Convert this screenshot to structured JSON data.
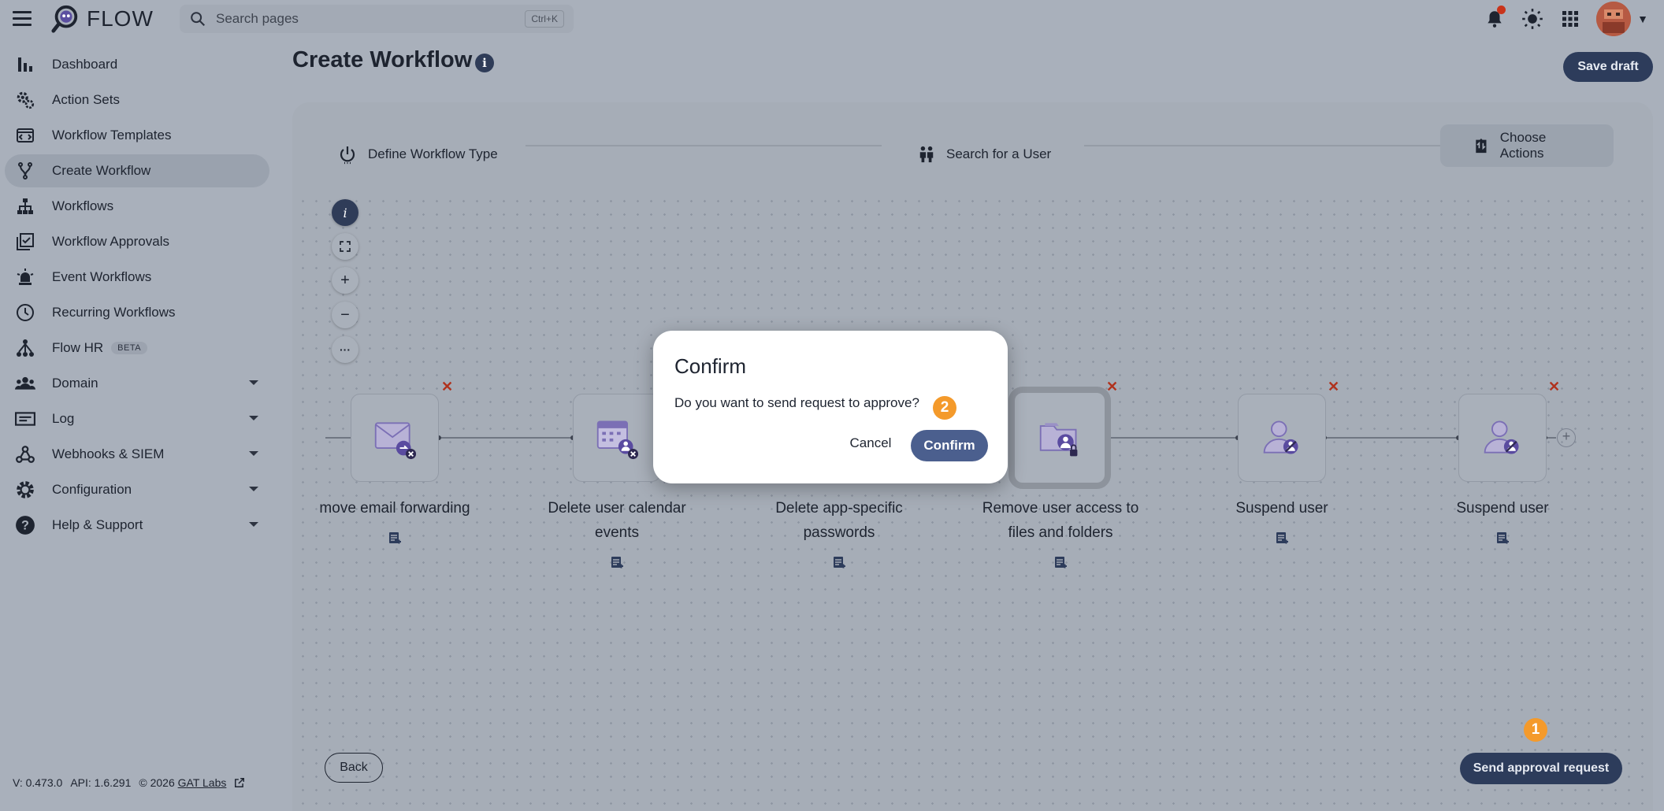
{
  "app": {
    "name": "FLOW"
  },
  "search": {
    "placeholder": "Search pages",
    "shortcut": "Ctrl+K"
  },
  "header": {
    "notification_dot_color": "#c9341b"
  },
  "sidebar": {
    "items": [
      {
        "label": "Dashboard",
        "icon": "bar-chart-icon"
      },
      {
        "label": "Action Sets",
        "icon": "gears-icon"
      },
      {
        "label": "Workflow Templates",
        "icon": "template-icon"
      },
      {
        "label": "Create Workflow",
        "icon": "branch-icon",
        "active": true
      },
      {
        "label": "Workflows",
        "icon": "sitemap-icon"
      },
      {
        "label": "Workflow Approvals",
        "icon": "approvals-icon"
      },
      {
        "label": "Event Workflows",
        "icon": "alarm-light-icon"
      },
      {
        "label": "Recurring Workflows",
        "icon": "clock-icon"
      },
      {
        "label": "Flow HR",
        "icon": "hr-tree-icon",
        "badge": "BETA"
      },
      {
        "label": "Domain",
        "icon": "people-icon"
      },
      {
        "label": "Log",
        "icon": "log-icon"
      },
      {
        "label": "Webhooks & SIEM",
        "icon": "webhook-icon"
      },
      {
        "label": "Configuration",
        "icon": "gear-icon"
      },
      {
        "label": "Help & Support",
        "icon": "help-icon"
      }
    ],
    "footer": {
      "version": "V: 0.473.0",
      "api": "API: 1.6.291",
      "copyright": "© 2026",
      "company": "GAT Labs"
    }
  },
  "main": {
    "title": "Create Workflow",
    "save_draft": "Save draft",
    "steps": [
      "Define Workflow Type",
      "Search for a User",
      "Choose Actions"
    ],
    "canvas_controls": [
      "i",
      "fit-view",
      "+",
      "−",
      "···"
    ],
    "nodes": [
      {
        "label": "move email forwarding",
        "icon": "email-forward-remove-icon"
      },
      {
        "label": "Delete user calendar events",
        "icon": "calendar-remove-icon"
      },
      {
        "label": "Delete app-specific passwords",
        "icon": "password-remove-icon"
      },
      {
        "label": "Remove user access to files and folders",
        "icon": "folder-lock-icon",
        "selected": true
      },
      {
        "label": "Suspend user",
        "icon": "user-suspend-icon"
      },
      {
        "label": "Suspend user",
        "icon": "user-suspend-icon"
      }
    ],
    "back": "Back",
    "send": "Send approval request",
    "badge_1": "1",
    "badge_2": "2"
  },
  "dialog": {
    "title": "Confirm",
    "message": "Do you want to send request to approve?",
    "cancel": "Cancel",
    "confirm": "Confirm"
  },
  "colors": {
    "primary": "#2d3c5b",
    "accent_badge": "#f49a2b",
    "delete_x": "#b0321d",
    "confirm_button": "#4b5f8e"
  }
}
